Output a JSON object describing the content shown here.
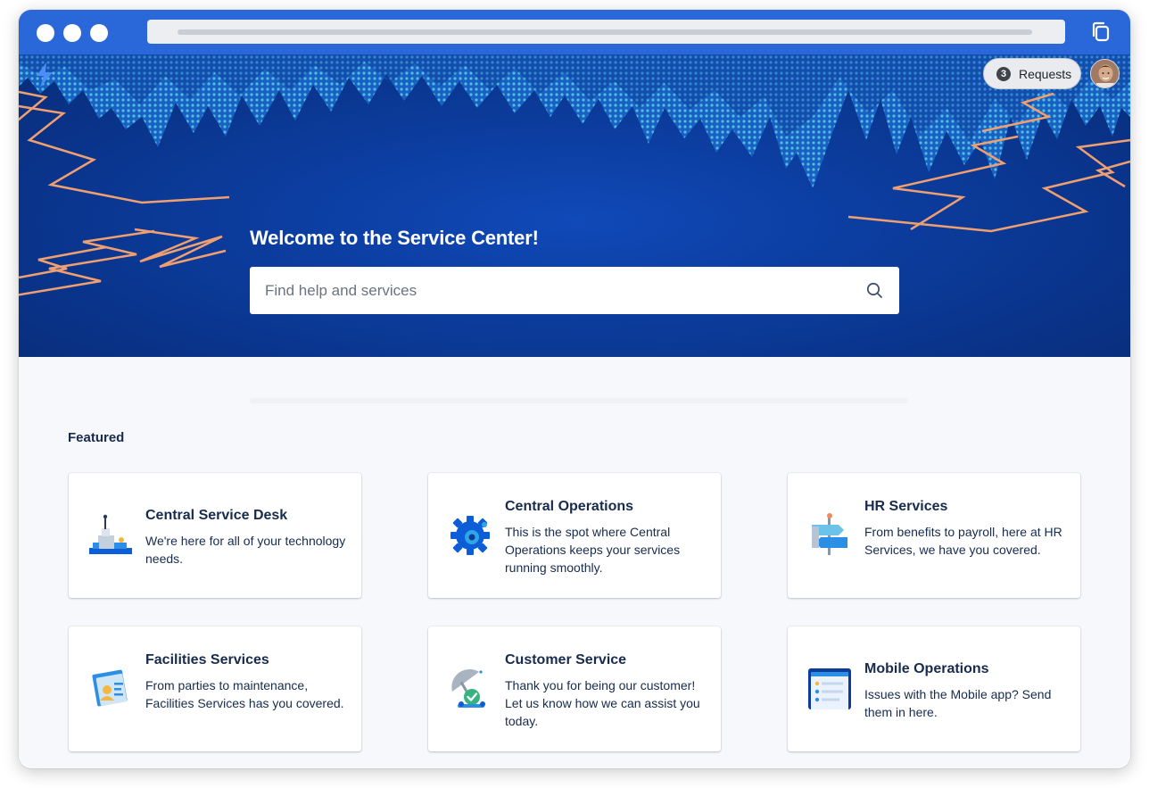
{
  "window": {
    "traffic_lights": [
      "close",
      "minimize",
      "maximize"
    ],
    "copy_icon": "copy-icon"
  },
  "header": {
    "logo_icon": "lightning-logo-icon",
    "requests_count": "3",
    "requests_label": "Requests",
    "avatar_icon": "user-avatar"
  },
  "hero": {
    "title": "Welcome to the Service Center!",
    "search_placeholder": "Find help and services",
    "search_value": "",
    "search_icon": "search-icon"
  },
  "featured": {
    "title": "Featured",
    "cards": [
      {
        "title": "Central Service Desk",
        "description": "We're here for all of your technology needs.",
        "icon": "mountain-flag-illustration-icon"
      },
      {
        "title": "Central Operations",
        "description": "This is the spot where Central Operations keeps your services running smoothly.",
        "icon": "gear-illustration-icon"
      },
      {
        "title": "HR Services",
        "description": "From benefits to payroll, here at HR Services, we have you covered.",
        "icon": "hr-signpost-illustration-icon"
      },
      {
        "title": "Facilities Services",
        "description": "From parties to maintenance, Facilities Services has you covered.",
        "icon": "id-card-illustration-icon"
      },
      {
        "title": "Customer Service",
        "description": "Thank you for being our customer! Let us know how we can assist you today.",
        "icon": "satellite-check-illustration-icon"
      },
      {
        "title": "Mobile Operations",
        "description": "Issues with the Mobile app? Send them in here.",
        "icon": "mobile-app-illustration-icon"
      }
    ]
  },
  "colors": {
    "titlebar": "#2a67d8",
    "hero_dark": "#082c78",
    "hero_mid": "#1049b8",
    "lightning": "#f0a070",
    "texture": "#3bb3d6",
    "card_text": "#172b4d"
  }
}
